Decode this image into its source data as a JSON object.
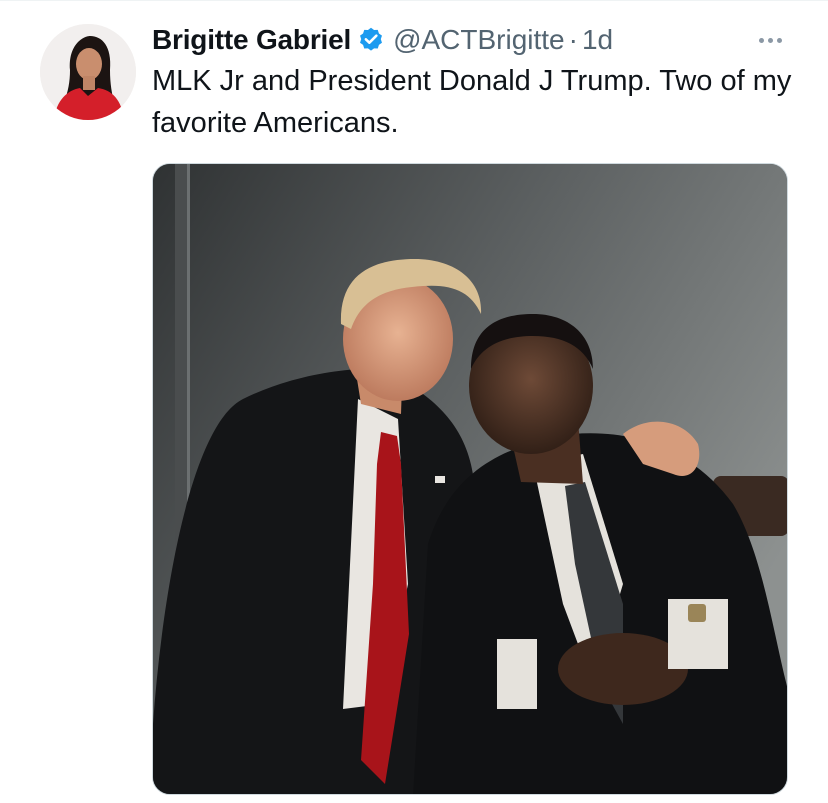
{
  "tweet": {
    "author": {
      "display_name": "Brigitte Gabriel",
      "handle": "@ACTBrigitte",
      "verified": true,
      "avatar_icon": "profile-photo"
    },
    "separator": "·",
    "timestamp": "1d",
    "text": "MLK Jr and President Donald J Trump. Two of my favorite Americans.",
    "more_icon": "more-horizontal-icon",
    "media": {
      "type": "photo"
    }
  },
  "colors": {
    "name": "#0f1419",
    "secondary": "#536471",
    "verified_badge": "#1d9bf0",
    "border": "#cfd9de"
  }
}
